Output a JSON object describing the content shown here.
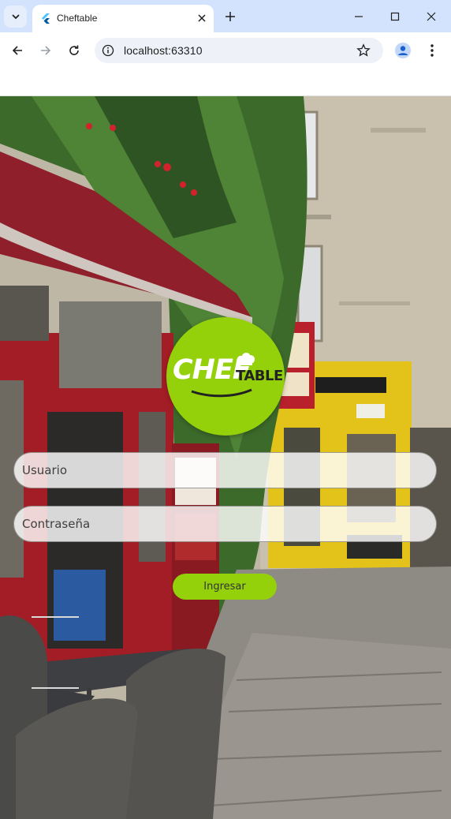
{
  "browser": {
    "tab_title": "Cheftable",
    "url": "localhost:63310"
  },
  "app": {
    "logo_word_1": "CHEF",
    "logo_word_2": "TABLE",
    "username_placeholder": "Usuario",
    "password_placeholder": "Contraseña",
    "submit_label": "Ingresar"
  },
  "colors": {
    "accent_green": "#94d10b",
    "tab_strip": "#d3e3fd"
  },
  "icons": [
    "tab-search-icon",
    "flutter-favicon-icon",
    "close-icon",
    "plus-icon",
    "minimize-icon",
    "maximize-icon",
    "window-close-icon",
    "back-arrow-icon",
    "forward-arrow-icon",
    "reload-icon",
    "site-info-icon",
    "star-icon",
    "profile-icon",
    "menu-icon"
  ]
}
